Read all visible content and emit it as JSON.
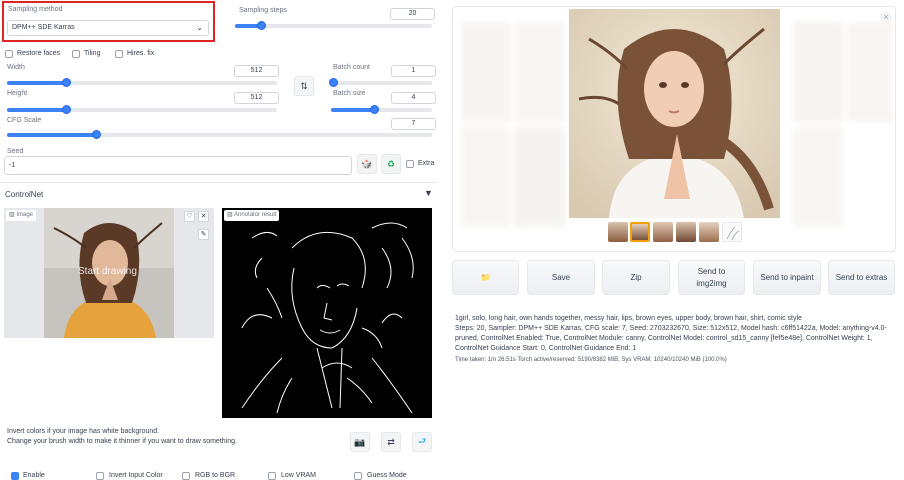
{
  "sampling": {
    "method_label": "Sampling method",
    "method_value": "DPM++ SDE Karras",
    "steps_label": "Sampling steps",
    "steps_value": "20",
    "steps_fraction": 0.13
  },
  "options": {
    "restore_faces": "Restore faces",
    "tiling": "Tiling",
    "hires_fix": "Hires. fix"
  },
  "size": {
    "width_label": "Width",
    "width_value": "512",
    "width_fraction": 0.22,
    "height_label": "Height",
    "height_value": "512",
    "height_fraction": 0.22,
    "batch_count_label": "Batch count",
    "batch_count_value": "1",
    "batch_count_fraction": 0.02,
    "batch_size_label": "Batch size",
    "batch_size_value": "4",
    "batch_size_fraction": 0.43,
    "swap_icon": "swap-icon"
  },
  "cfg": {
    "label": "CFG Scale",
    "value": "7",
    "fraction": 0.21
  },
  "seed": {
    "label": "Seed",
    "value": "-1",
    "extra_label": "Extra"
  },
  "controlnet": {
    "title": "ControlNet",
    "image_label": "Image",
    "start_drawing": "Start drawing",
    "annotator_label": "Annotator result",
    "hint_invert": "Invert colors if your image has white background.",
    "hint_brush": "Change your brush width to make it thinner if you want to draw something.",
    "checkboxes": [
      "Enable",
      "Invert Input Color",
      "RGB to BGR",
      "Low VRAM",
      "Guess Mode"
    ]
  },
  "output": {
    "buttons": {
      "folder": "📁",
      "save": "Save",
      "zip": "Zip",
      "img2img": "Send to img2img",
      "inpaint": "Send to inpaint",
      "extras": "Send to extras"
    },
    "close": "×",
    "info_prompt": "1girl, solo, long hair, own hands together, messy hair, lips, brown eyes, upper body, brown hair, shirt, comic style",
    "info_params": "Steps: 20, Sampler: DPM++ SDE Karras, CFG scale: 7, Seed: 2703232670, Size: 512x512, Model hash: c6ff51422a, Model: anything-v4.0-pruned, ControlNet Enabled: True, ControlNet Module: canny, ControlNet Model: control_sd15_canny [fef5e48e], ControlNet Weight: 1, ControlNet Guidance Start: 0, ControlNet Guidance End: 1",
    "info_time": "Time taken: 1m 26.51s  Torch active/reserved: 5190/8382 MiB, Sys VRAM: 10240/10240 MiB (100.0%)"
  },
  "colors": {
    "accent": "#3b82f6",
    "highlight_border": "#dc2626"
  }
}
